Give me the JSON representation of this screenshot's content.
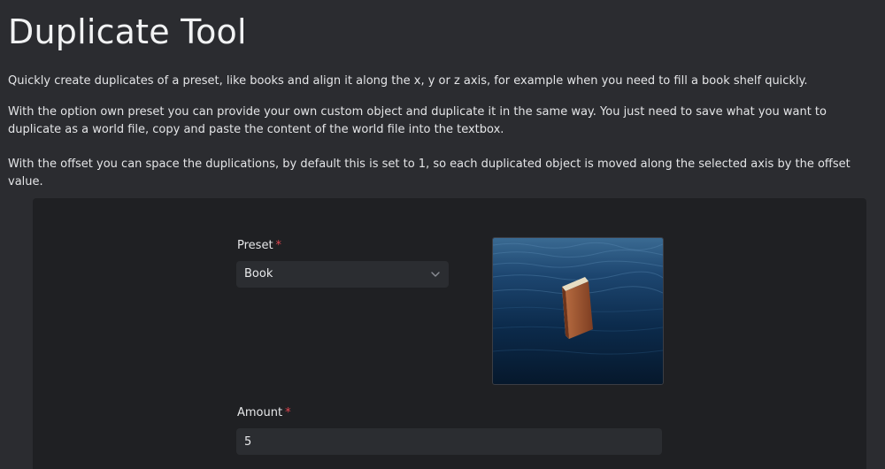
{
  "page_title": "Duplicate Tool",
  "paragraphs": {
    "p1": "Quickly create duplicates of a preset, like books and align it along the x, y or z axis, for example when you need to fill a book shelf quickly.",
    "p2": "With the option own preset you can provide your own custom object and duplicate it in the same way. You just need to save what you want to duplicate as a world file, copy and paste the content of the world file into the textbox.",
    "p3": "With the offset you can space the duplications, by default this is set to 1, so each duplicated object is moved along the selected axis by the offset value."
  },
  "form": {
    "preset": {
      "label": "Preset",
      "required_mark": "*",
      "value": "Book"
    },
    "amount": {
      "label": "Amount",
      "required_mark": "*",
      "value": "5"
    }
  },
  "icons": {
    "dropdown": "chevron-down-icon"
  },
  "colors": {
    "background": "#2b2c30",
    "panel": "#1f2023",
    "field": "#2b2d31",
    "required": "#e0454f",
    "water": "#0b2a4a",
    "book": "#9a4f2c"
  }
}
